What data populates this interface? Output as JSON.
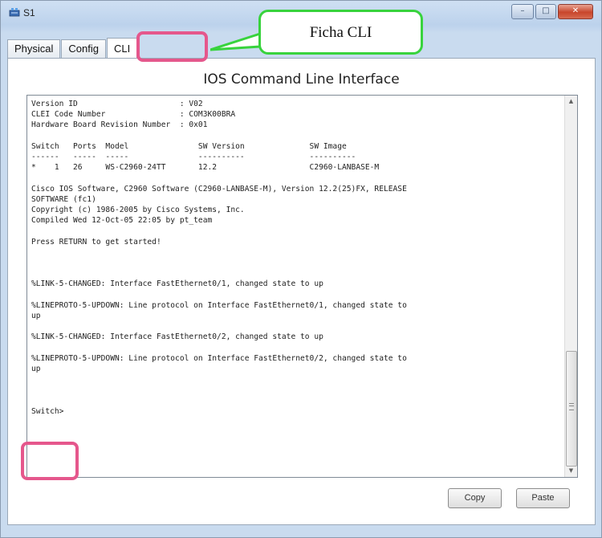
{
  "window": {
    "title": "S1",
    "controls": {
      "minimize": "–",
      "maximize": "□",
      "close": "✕"
    }
  },
  "tabs": [
    {
      "label": "Physical",
      "active": false
    },
    {
      "label": "Config",
      "active": false
    },
    {
      "label": "CLI",
      "active": true
    }
  ],
  "cli": {
    "heading": "IOS Command Line Interface",
    "lines": [
      "Version ID                      : V02",
      "CLEI Code Number                : COM3K00BRA",
      "Hardware Board Revision Number  : 0x01",
      "",
      "Switch   Ports  Model               SW Version              SW Image",
      "------   -----  -----               ----------              ----------",
      "*    1   26     WS-C2960-24TT       12.2                    C2960-LANBASE-M",
      "",
      "Cisco IOS Software, C2960 Software (C2960-LANBASE-M), Version 12.2(25)FX, RELEASE",
      "SOFTWARE (fc1)",
      "Copyright (c) 1986-2005 by Cisco Systems, Inc.",
      "Compiled Wed 12-Oct-05 22:05 by pt_team",
      "",
      "Press RETURN to get started!",
      "",
      "",
      "",
      "%LINK-5-CHANGED: Interface FastEthernet0/1, changed state to up",
      "",
      "%LINEPROTO-5-UPDOWN: Line protocol on Interface FastEthernet0/1, changed state to",
      "up",
      "",
      "%LINK-5-CHANGED: Interface FastEthernet0/2, changed state to up",
      "",
      "%LINEPROTO-5-UPDOWN: Line protocol on Interface FastEthernet0/2, changed state to",
      "up",
      "",
      "",
      "",
      "Switch>"
    ],
    "buttons": {
      "copy": "Copy",
      "paste": "Paste"
    }
  },
  "annotations": {
    "callout_text": "Ficha CLI",
    "highlight_color": "#e5578c",
    "callout_color": "#38d33d"
  },
  "icons": {
    "app": "network-device-icon",
    "scroll_up": "arrow-up-icon",
    "scroll_down": "arrow-down-icon"
  }
}
